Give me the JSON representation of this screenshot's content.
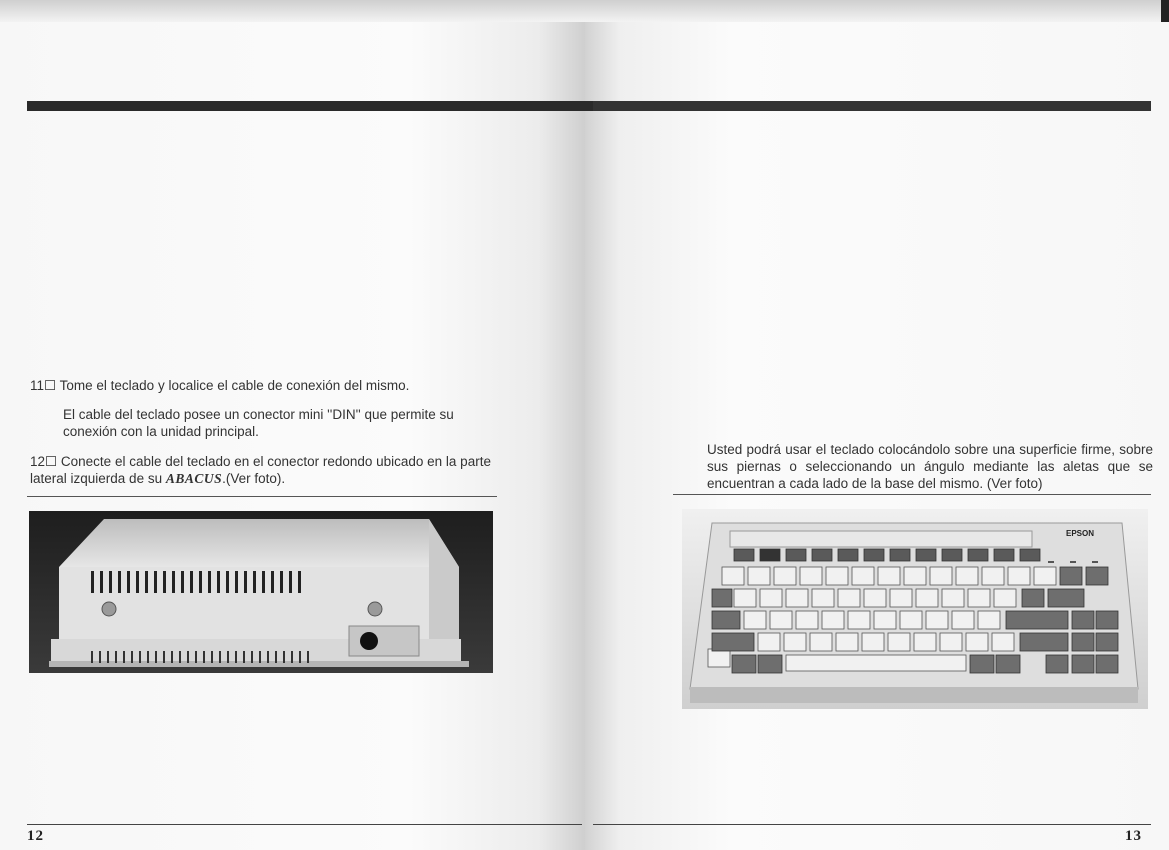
{
  "left_page": {
    "step11": {
      "number": "11",
      "checkbox": "☐",
      "text": "Tome el teclado y localice el cable de conexión del mismo.",
      "detail": "El cable del teclado posee un conector mini ''DIN'' que permite su conexión con la unidad principal."
    },
    "step12": {
      "number": "12",
      "checkbox": "☐",
      "text_before": "Conecte el cable del teclado en el conector redondo ubicado en la parte lateral izquierda de su ",
      "brand": "ABACUS",
      "text_after": ".(Ver foto)."
    },
    "page_number": "12"
  },
  "right_page": {
    "paragraph": "Usted podrá usar el teclado colocándolo sobre una superficie firme, sobre sus piernas o seleccionando un ángulo mediante las aletas que se encuentran a cada lado de la base del mismo. (Ver foto)",
    "keyboard_brand": "EPSON",
    "page_number": "13"
  }
}
